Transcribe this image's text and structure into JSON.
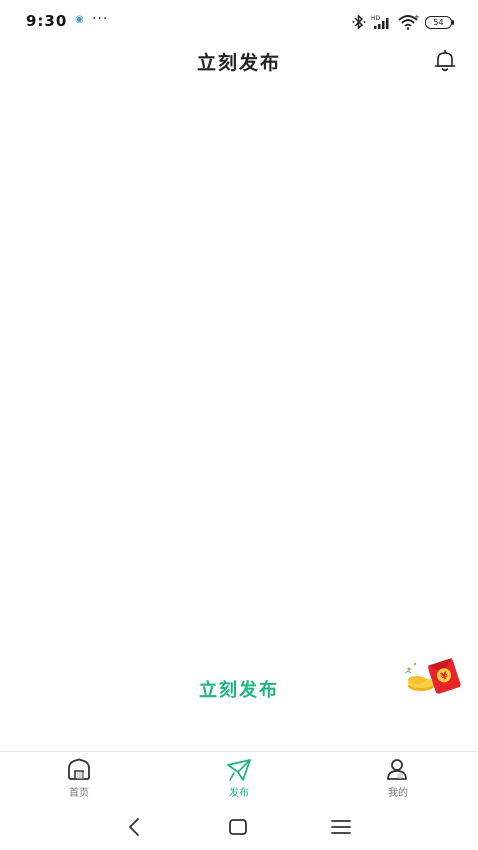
{
  "status_bar": {
    "time": "9:30",
    "notification_dots": "···",
    "battery_level": "54"
  },
  "header": {
    "title": "立刻发布"
  },
  "main": {
    "publish_text": "立刻发布",
    "accent_color": "#1fb582"
  },
  "tab_bar": {
    "tabs": [
      {
        "label": "首页",
        "icon": "home-icon",
        "active": false
      },
      {
        "label": "发布",
        "icon": "send-icon",
        "active": true
      },
      {
        "label": "我的",
        "icon": "profile-icon",
        "active": false
      }
    ]
  },
  "nav_bar": {
    "buttons": [
      "back-icon",
      "home-square-icon",
      "menu-icon"
    ]
  }
}
